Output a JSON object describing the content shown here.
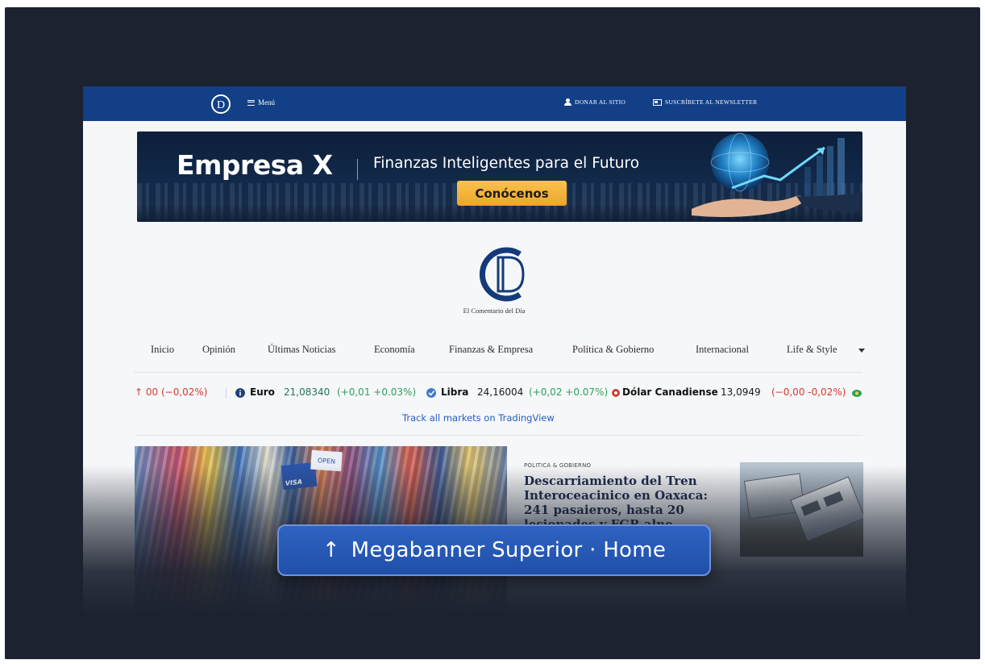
{
  "topbar": {
    "menu_label": "Menú",
    "donate_label": "DONAR AL SITIO",
    "subscribe_label": "SUSCRÍBETE AL NEWSLETTER"
  },
  "ad": {
    "brand": "Empresa X",
    "tagline": "Finanzas Inteligentes para el Futuro",
    "cta": "Conócenos"
  },
  "masthead": {
    "name": "El Comentario del Día"
  },
  "nav": {
    "items": [
      "Inicio",
      "Opinión",
      "Últimas Noticias",
      "Economía",
      "Finanzas & Empresa",
      "Política & Gobierno",
      "Internacional",
      "Life & Style"
    ]
  },
  "ticker": {
    "first_change": "↑ 00 (−0,02%)",
    "euro": {
      "name": "Euro",
      "value": "21,08340",
      "change": "(+0,01 +0.03%)"
    },
    "libra": {
      "name": "Libra",
      "value": "24,16004",
      "change": "(+0,02 +0.07%)"
    },
    "cad": {
      "name": "Dólar Canadiense",
      "value": "13,0949",
      "change": "(−0,00 -0,02%)"
    },
    "tradingview_link": "Track all markets on TradingView"
  },
  "article": {
    "kicker": "POLITICA & GOBIERNO",
    "headline": "Descarriamiento del Tren Interoceacinico en Oaxaca: 241 pasaieros, hasta 20 lesionades y FGR alne",
    "visa_text": "VISA",
    "open_text": "OPEN"
  },
  "overlay": {
    "label": "Megabanner Superior · Home",
    "arrow": "↑"
  },
  "colors": {
    "topbar": "#123f86",
    "backdrop": "#1c2230",
    "cta": "#f4b43a",
    "pill": "#2a5bb8"
  }
}
